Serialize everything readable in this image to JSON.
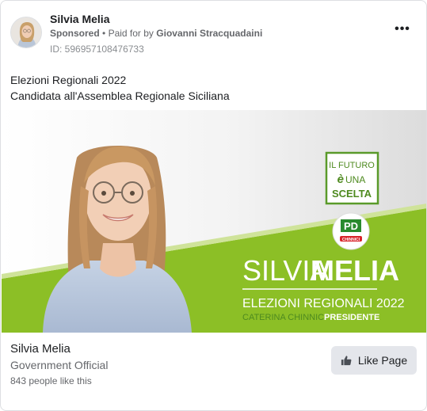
{
  "header": {
    "page_name": "Silvia Melia",
    "sponsored": "Sponsored",
    "separator": "•",
    "paid_for_prefix": "Paid for by",
    "payer": "Giovanni Stracquadaini",
    "ad_id": "ID: 596957108476733",
    "more_icon": "more-horizontal-icon",
    "more_label": "•••"
  },
  "caption": {
    "line1": "Elezioni Regionali 2022",
    "line2": "Candidata all'Assemblea Regionale Siciliana"
  },
  "creative": {
    "badge_line1": "IL FUTURO",
    "badge_line2_e": "è",
    "badge_line2": "UNA",
    "badge_line3": "SCELTA",
    "party_logo": "pd-party-logo",
    "party_logo_letters": "PD",
    "party_logo_text": "CHINNICI",
    "candidate_first": "SILVIA",
    "candidate_last": "MELIA",
    "election": "ELEZIONI REGIONALI 2022",
    "president_name": "CATERINA CHINNICI",
    "president_role": "PRESIDENTE",
    "colors": {
      "green": "#8cbf26",
      "dark_green": "#4e8a1f",
      "badge_green": "#5a9a2a",
      "red": "#d8232a"
    }
  },
  "footer": {
    "name": "Silvia Melia",
    "category": "Government Official",
    "likes": "843 people like this",
    "like_button": "Like Page",
    "like_icon": "thumbs-up-icon"
  }
}
